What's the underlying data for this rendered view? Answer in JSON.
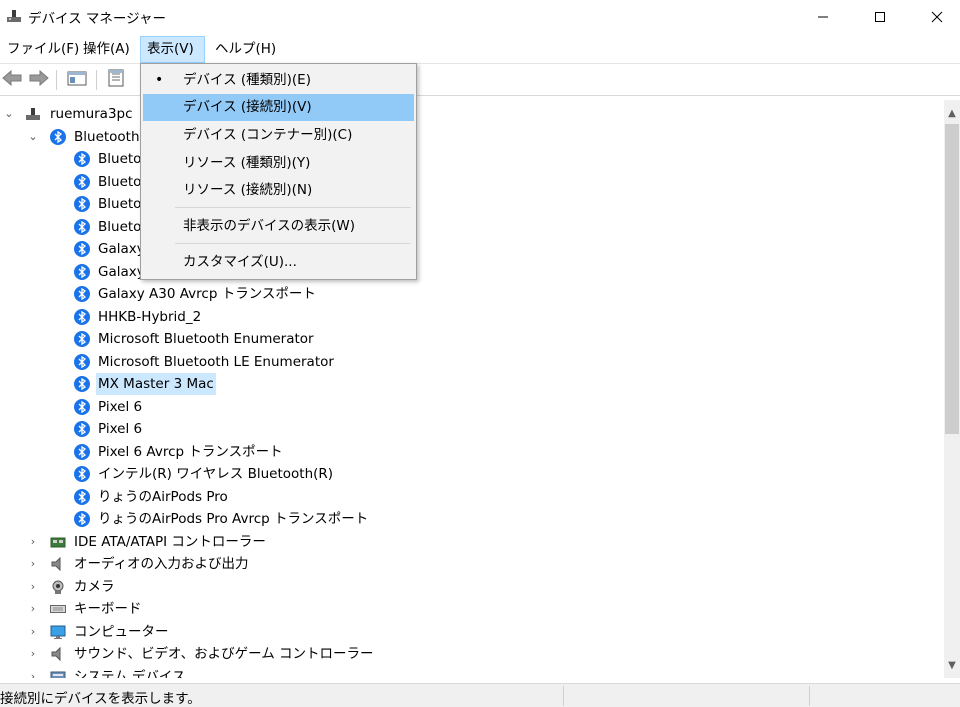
{
  "window": {
    "title": "デバイス マネージャー",
    "minimize_icon": "minimize-icon",
    "maximize_icon": "maximize-icon",
    "close_icon": "close-icon"
  },
  "menubar": {
    "items": [
      {
        "label": "ファイル(F)"
      },
      {
        "label": "操作(A)"
      },
      {
        "label": "表示(V)"
      },
      {
        "label": "ヘルプ(H)"
      }
    ]
  },
  "toolbar": {
    "buttons": [
      "back-arrow-icon",
      "forward-arrow-icon",
      "console-tree-icon",
      "properties-icon"
    ]
  },
  "view_menu": {
    "items": [
      {
        "label": "デバイス (種類別)(E)",
        "checked": true
      },
      {
        "label": "デバイス (接続別)(V)",
        "highlighted": true
      },
      {
        "label": "デバイス (コンテナー別)(C)"
      },
      {
        "label": "リソース (種類別)(Y)"
      },
      {
        "label": "リソース (接続別)(N)"
      },
      {
        "label": "非表示のデバイスの表示(W)"
      },
      {
        "label": "カスタマイズ(U)..."
      }
    ],
    "bullet": "•"
  },
  "tree": {
    "root": "ruemura3pc",
    "bluetooth_category": "Bluetooth",
    "bluetooth_children": [
      "Bluetooth",
      "Bluetooth",
      "Bluetooth",
      "Bluetooth",
      "Galaxy",
      "Galaxy",
      "Galaxy A30 Avrcp トランスポート",
      "HHKB-Hybrid_2",
      "Microsoft Bluetooth Enumerator",
      "Microsoft Bluetooth LE Enumerator",
      "MX Master 3 Mac",
      "Pixel 6",
      "Pixel 6",
      "Pixel 6 Avrcp トランスポート",
      "インテル(R) ワイヤレス Bluetooth(R)",
      "りょうのAirPods Pro",
      "りょうのAirPods Pro Avrcp トランスポート"
    ],
    "selected_child_index": 10,
    "categories": [
      {
        "label": "IDE ATA/ATAPI コントローラー",
        "icon": "ide-controller-icon"
      },
      {
        "label": "オーディオの入力および出力",
        "icon": "speaker-icon"
      },
      {
        "label": "カメラ",
        "icon": "camera-icon"
      },
      {
        "label": "キーボード",
        "icon": "keyboard-icon"
      },
      {
        "label": "コンピューター",
        "icon": "monitor-icon"
      },
      {
        "label": "サウンド、ビデオ、およびゲーム コントローラー",
        "icon": "speaker-icon"
      },
      {
        "label": "システム デバイス",
        "icon": "system-device-icon"
      }
    ]
  },
  "statusbar": {
    "text": "接続別にデバイスを表示します。"
  },
  "colors": {
    "selection": "#cce8ff",
    "menu_highlight": "#91c9f7",
    "bluetooth": "#1a73e8"
  }
}
